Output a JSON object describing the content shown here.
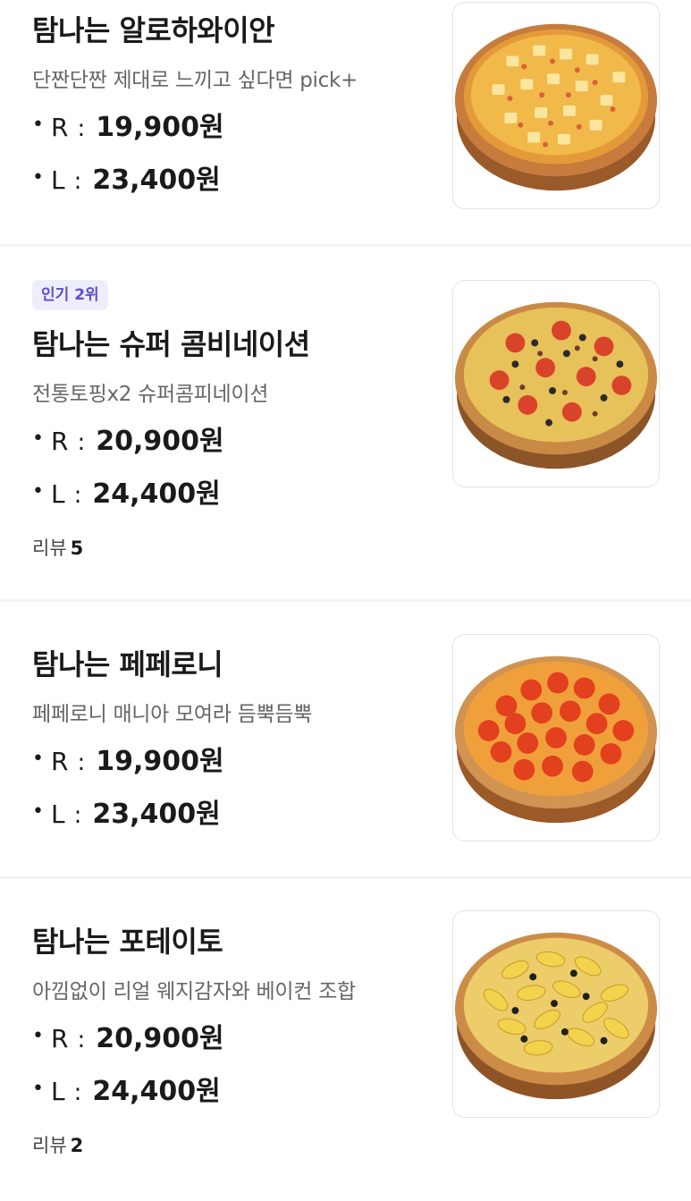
{
  "menu": {
    "items": [
      {
        "name": "탐나는 알로하와이안",
        "description": "단짠단짠 제대로 느끼고 싶다면 pick+",
        "badge": "",
        "prices": [
          {
            "size": "R",
            "amount": "19,900원"
          },
          {
            "size": "L",
            "amount": "23,400원"
          }
        ],
        "review_label": "",
        "review_count": "",
        "image_icon": "hawaiian-pizza-image"
      },
      {
        "name": "탐나는 슈퍼 콤비네이션",
        "description": "전통토핑x2 슈퍼콤피네이션",
        "badge": "인기 2위",
        "prices": [
          {
            "size": "R",
            "amount": "20,900원"
          },
          {
            "size": "L",
            "amount": "24,400원"
          }
        ],
        "review_label": "리뷰",
        "review_count": "5",
        "image_icon": "combination-pizza-image"
      },
      {
        "name": "탐나는 페페로니",
        "description": "페페로니 매니아 모여라 듬뿍듬뿍",
        "badge": "",
        "prices": [
          {
            "size": "R",
            "amount": "19,900원"
          },
          {
            "size": "L",
            "amount": "23,400원"
          }
        ],
        "review_label": "",
        "review_count": "",
        "image_icon": "pepperoni-pizza-image"
      },
      {
        "name": "탐나는 포테이토",
        "description": "아낌없이 리얼 웨지감자와 베이컨 조합",
        "badge": "",
        "prices": [
          {
            "size": "R",
            "amount": "20,900원"
          },
          {
            "size": "L",
            "amount": "24,400원"
          }
        ],
        "review_label": "리뷰",
        "review_count": "2",
        "image_icon": "potato-pizza-image"
      }
    ]
  },
  "bullet_glyph": "•",
  "colon_glyph": ":",
  "colors": {
    "background": "#f4f4f6",
    "card": "#ffffff",
    "badge_bg": "#eeeefb",
    "badge_text": "#5b4fd6",
    "description": "#666666"
  }
}
